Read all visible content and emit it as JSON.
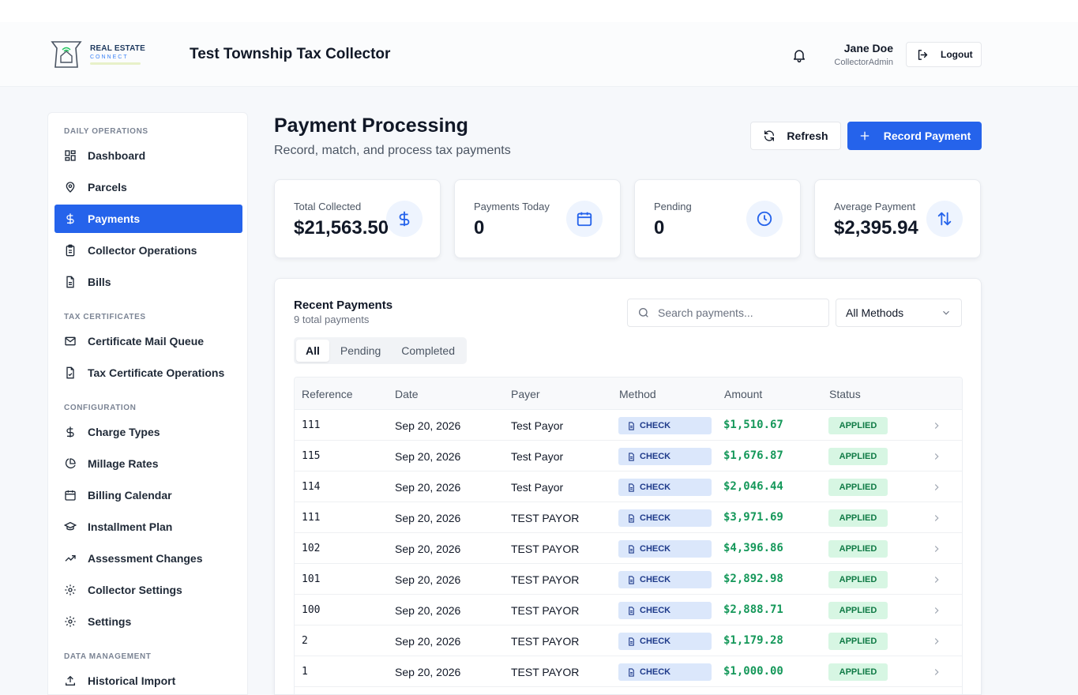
{
  "header": {
    "logo": {
      "line1": "REAL ESTATE",
      "line2": "CONNECT"
    },
    "app_title": "Test Township Tax Collector",
    "user_name": "Jane Doe",
    "user_role": "CollectorAdmin",
    "logout_label": "Logout"
  },
  "sidebar": {
    "sections": {
      "daily": "DAILY OPERATIONS",
      "tax_certs": "TAX CERTIFICATES",
      "config": "CONFIGURATION",
      "data_mgmt": "DATA MANAGEMENT"
    },
    "items": [
      {
        "label": "Dashboard",
        "icon": "dashboard-icon"
      },
      {
        "label": "Parcels",
        "icon": "map-pin-icon"
      },
      {
        "label": "Payments",
        "icon": "dollar-icon",
        "active": true
      },
      {
        "label": "Collector Operations",
        "icon": "clipboard-icon"
      },
      {
        "label": "Bills",
        "icon": "file-icon"
      },
      {
        "label": "Certificate Mail Queue",
        "icon": "mail-icon"
      },
      {
        "label": "Tax Certificate Operations",
        "icon": "file-check-icon"
      },
      {
        "label": "Charge Types",
        "icon": "dollar-icon"
      },
      {
        "label": "Millage Rates",
        "icon": "pie-chart-icon"
      },
      {
        "label": "Billing Calendar",
        "icon": "calendar-icon"
      },
      {
        "label": "Installment Plan",
        "icon": "graduation-cap-icon"
      },
      {
        "label": "Assessment Changes",
        "icon": "trending-up-icon"
      },
      {
        "label": "Collector Settings",
        "icon": "gear-icon"
      },
      {
        "label": "Settings",
        "icon": "gear-icon"
      },
      {
        "label": "Historical Import",
        "icon": "upload-icon"
      }
    ]
  },
  "page": {
    "title": "Payment Processing",
    "subtitle": "Record, match, and process tax payments",
    "refresh_label": "Refresh",
    "record_label": "Record Payment"
  },
  "stats": [
    {
      "label": "Total Collected",
      "value": "$21,563.50",
      "icon": "dollar-icon"
    },
    {
      "label": "Payments Today",
      "value": "0",
      "icon": "calendar-icon"
    },
    {
      "label": "Pending",
      "value": "0",
      "icon": "clock-icon"
    },
    {
      "label": "Average Payment",
      "value": "$2,395.94",
      "icon": "arrows-up-down-icon"
    }
  ],
  "recent": {
    "title": "Recent Payments",
    "subtitle": "9 total payments",
    "search_placeholder": "Search payments...",
    "method_filter": "All Methods",
    "tabs": [
      "All",
      "Pending",
      "Completed"
    ],
    "active_tab": "All",
    "columns": [
      "Reference",
      "Date",
      "Payer",
      "Method",
      "Amount",
      "Status"
    ],
    "rows": [
      {
        "ref": "111",
        "date": "Sep 20, 2026",
        "payer": "Test Payor",
        "method": "CHECK",
        "amount": "$1,510.67",
        "status": "APPLIED"
      },
      {
        "ref": "115",
        "date": "Sep 20, 2026",
        "payer": "Test Payor",
        "method": "CHECK",
        "amount": "$1,676.87",
        "status": "APPLIED"
      },
      {
        "ref": "114",
        "date": "Sep 20, 2026",
        "payer": "Test Payor",
        "method": "CHECK",
        "amount": "$2,046.44",
        "status": "APPLIED"
      },
      {
        "ref": "111",
        "date": "Sep 20, 2026",
        "payer": "TEST PAYOR",
        "method": "CHECK",
        "amount": "$3,971.69",
        "status": "APPLIED"
      },
      {
        "ref": "102",
        "date": "Sep 20, 2026",
        "payer": "TEST PAYOR",
        "method": "CHECK",
        "amount": "$4,396.86",
        "status": "APPLIED"
      },
      {
        "ref": "101",
        "date": "Sep 20, 2026",
        "payer": "TEST PAYOR",
        "method": "CHECK",
        "amount": "$2,892.98",
        "status": "APPLIED"
      },
      {
        "ref": "100",
        "date": "Sep 20, 2026",
        "payer": "TEST PAYOR",
        "method": "CHECK",
        "amount": "$2,888.71",
        "status": "APPLIED"
      },
      {
        "ref": "2",
        "date": "Sep 20, 2026",
        "payer": "TEST PAYOR",
        "method": "CHECK",
        "amount": "$1,179.28",
        "status": "APPLIED"
      },
      {
        "ref": "1",
        "date": "Sep 20, 2026",
        "payer": "TEST PAYOR",
        "method": "CHECK",
        "amount": "$1,000.00",
        "status": "APPLIED"
      }
    ]
  },
  "colors": {
    "accent": "#2563eb",
    "amount_green": "#15985a",
    "status_bg": "#d7f6e3",
    "method_bg": "#dbe7fb"
  }
}
